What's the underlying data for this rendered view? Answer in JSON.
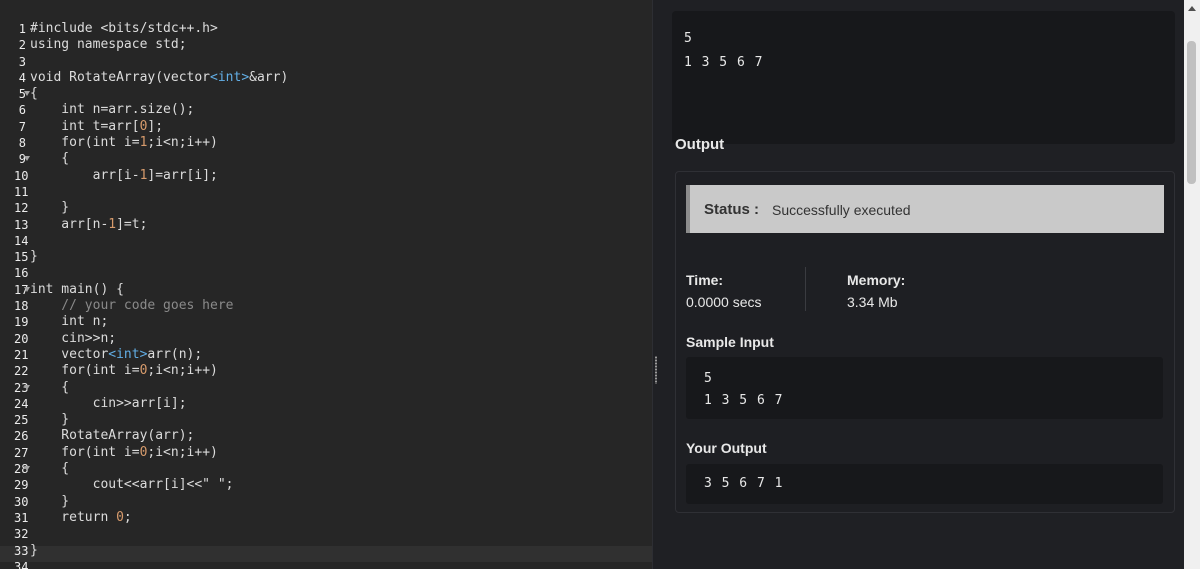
{
  "editor": {
    "folded_lines": [
      5,
      9,
      17,
      23,
      28
    ],
    "lines": [
      [
        [
          "#include <bits/stdc++.h>",
          "t"
        ]
      ],
      [
        [
          "using namespace std;",
          "t"
        ]
      ],
      [
        [
          "",
          "t"
        ]
      ],
      [
        [
          "void RotateArray(vector",
          "t"
        ],
        [
          "<int>",
          "o"
        ],
        [
          "&arr)",
          "t"
        ]
      ],
      [
        [
          "{",
          "t"
        ]
      ],
      [
        [
          "    int n=arr.size();",
          "t"
        ]
      ],
      [
        [
          "    int t=arr[",
          "t"
        ],
        [
          "0",
          "n"
        ],
        [
          "];",
          "t"
        ]
      ],
      [
        [
          "    for(int i=",
          "t"
        ],
        [
          "1",
          "n"
        ],
        [
          ";i<n;i++)",
          "t"
        ]
      ],
      [
        [
          "    {",
          "t"
        ]
      ],
      [
        [
          "        arr[i-",
          "t"
        ],
        [
          "1",
          "n"
        ],
        [
          "]=arr[i];",
          "t"
        ]
      ],
      [
        [
          "",
          "t"
        ]
      ],
      [
        [
          "    }",
          "t"
        ]
      ],
      [
        [
          "    arr[n-",
          "t"
        ],
        [
          "1",
          "n"
        ],
        [
          "]=t;",
          "t"
        ]
      ],
      [
        [
          "",
          "t"
        ]
      ],
      [
        [
          "}",
          "t"
        ]
      ],
      [
        [
          "",
          "t"
        ]
      ],
      [
        [
          "int main() {",
          "t"
        ]
      ],
      [
        [
          "    // your code goes here",
          "c"
        ]
      ],
      [
        [
          "    int n;",
          "t"
        ]
      ],
      [
        [
          "    cin>>n;",
          "t"
        ]
      ],
      [
        [
          "    vector",
          "t"
        ],
        [
          "<int>",
          "o"
        ],
        [
          "arr(n);",
          "t"
        ]
      ],
      [
        [
          "    for(int i=",
          "t"
        ],
        [
          "0",
          "n"
        ],
        [
          ";i<n;i++)",
          "t"
        ]
      ],
      [
        [
          "    {",
          "t"
        ]
      ],
      [
        [
          "        cin>>arr[i];",
          "t"
        ]
      ],
      [
        [
          "    }",
          "t"
        ]
      ],
      [
        [
          "    RotateArray(arr);",
          "t"
        ]
      ],
      [
        [
          "    for(int i=",
          "t"
        ],
        [
          "0",
          "n"
        ],
        [
          ";i<n;i++)",
          "t"
        ]
      ],
      [
        [
          "    {",
          "t"
        ]
      ],
      [
        [
          "        cout<<arr[i]<<\" \";",
          "t"
        ]
      ],
      [
        [
          "    }",
          "t"
        ]
      ],
      [
        [
          "    return ",
          "t"
        ],
        [
          "0",
          "n"
        ],
        [
          ";",
          "t"
        ]
      ],
      [
        [
          "",
          "t"
        ]
      ],
      [
        [
          "}",
          "t"
        ]
      ],
      [
        [
          "",
          "t"
        ]
      ]
    ]
  },
  "input": {
    "line1": "5",
    "line2": "1 3 5 6 7"
  },
  "output": {
    "heading": "Output",
    "status_label": "Status :",
    "status_value": "Successfully executed",
    "time_label": "Time:",
    "time_value": "0.0000 secs",
    "memory_label": "Memory:",
    "memory_value": "3.34 Mb",
    "sample_input_label": "Sample Input",
    "sample_input_line1": "5",
    "sample_input_line2": "1 3 5 6 7",
    "your_output_label": "Your Output",
    "your_output_value": "3 5 6 7 1"
  },
  "colors": {
    "editor_bg": "#262626",
    "panel_bg": "#1f2024",
    "status_bg": "#c9c9c9"
  }
}
